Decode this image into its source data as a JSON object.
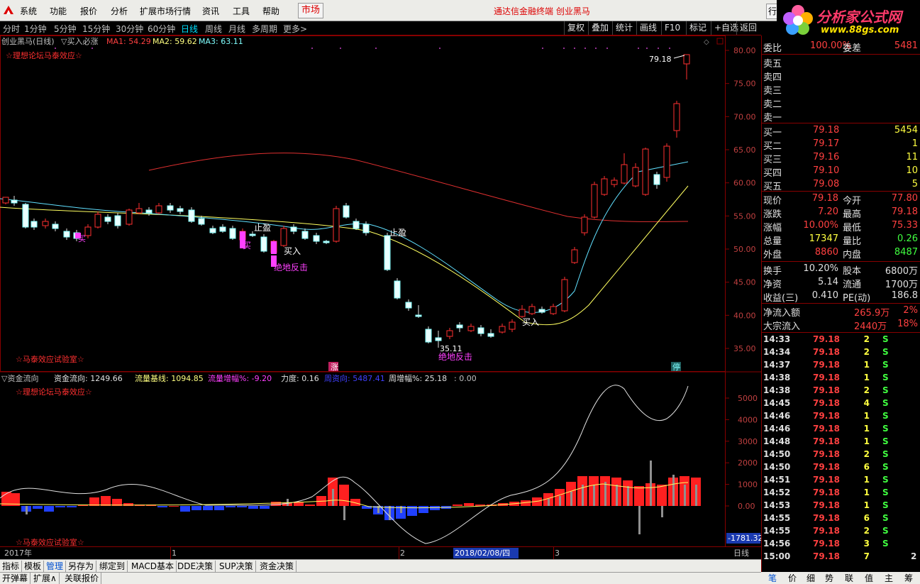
{
  "menu": {
    "items": [
      "系统",
      "功能",
      "报价",
      "分析",
      "扩展市场行情",
      "资讯",
      "工具",
      "帮助"
    ],
    "market": "市场",
    "title": "通达信金融终端  创业黑马",
    "window_btn": "行",
    "brand_line1": "分析家公式网",
    "brand_line2": "www.88gs.com"
  },
  "toolbar": {
    "periods": [
      "分时",
      "1分钟",
      "5分钟",
      "15分钟",
      "30分钟",
      "60分钟",
      "日线",
      "周线",
      "月线",
      "多周期",
      "更多>"
    ],
    "active_period": "日线",
    "right_buttons": [
      "复权",
      "叠加",
      "统计",
      "画线",
      "F10",
      "标记",
      "+自选",
      "返回"
    ]
  },
  "main_chart": {
    "stock": "创业黑马(日线)",
    "indicator": "▽买入必涨",
    "ma1": "MA1: 54.29",
    "ma2": "MA2: 59.62",
    "ma3": "MA3: 63.11",
    "watermark_top": "☆理想论坛马泰效应☆",
    "watermark_bottom": "☆马泰效应试验室☆",
    "price_axis": [
      "80.00",
      "75.00",
      "70.00",
      "65.00",
      "60.00",
      "55.00",
      "50.00",
      "45.00",
      "40.00",
      "35.00"
    ],
    "high_label": "79.18",
    "low_label": "35.11",
    "signals": {
      "buy1": "买",
      "buy2": "买",
      "buy_in1": "买入",
      "buy_in2": "买入",
      "stop1": "止盈",
      "stop2": "止盈",
      "rebound1": "绝地反击",
      "rebound2": "绝地反击",
      "rise": "涨",
      "limit": "停"
    }
  },
  "sub_chart": {
    "name": "▽资金流向",
    "flow": "资金流向: 1249.66",
    "base": "流量基线: 1094.85",
    "inc": "流量增幅%: -9.20",
    "force": "力度: 0.16",
    "weekly": "周资向: 5487.41",
    "weekly_inc": "周增幅%: 25.18",
    "zero": ": 0.00",
    "watermark_top": "☆理想论坛马泰效应☆",
    "watermark_bottom": "☆马泰效应试验室☆",
    "axis": [
      "5000",
      "4000",
      "3000",
      "2000",
      "1000",
      "0.00"
    ],
    "cursor_value": "-1781.32"
  },
  "time_axis": {
    "year": "2017年",
    "m1": "1",
    "m2": "2",
    "m3": "3",
    "cursor_date": "2018/02/08/四",
    "period": "日线"
  },
  "quote": {
    "weibi_label": "委比",
    "weibi": "100.00%",
    "weicha_label": "委差",
    "weicha": "5481",
    "sells": [
      "卖五",
      "卖四",
      "卖三",
      "卖二",
      "卖一"
    ],
    "buys": [
      {
        "label": "买一",
        "price": "79.18",
        "vol": "5454"
      },
      {
        "label": "买二",
        "price": "79.17",
        "vol": "1"
      },
      {
        "label": "买三",
        "price": "79.16",
        "vol": "11"
      },
      {
        "label": "买四",
        "price": "79.10",
        "vol": "10"
      },
      {
        "label": "买五",
        "price": "79.08",
        "vol": "5"
      }
    ],
    "stats": [
      [
        "现价",
        "79.18",
        "今开",
        "77.80"
      ],
      [
        "涨跌",
        "7.20",
        "最高",
        "79.18"
      ],
      [
        "涨幅",
        "10.00%",
        "最低",
        "75.33"
      ],
      [
        "总量",
        "17347",
        "量比",
        "0.26"
      ],
      [
        "外盘",
        "8860",
        "内盘",
        "8487"
      ]
    ],
    "stats2": [
      [
        "换手",
        "10.20%",
        "股本",
        "6800万"
      ],
      [
        "净资",
        "5.14",
        "流通",
        "1700万"
      ],
      [
        "收益(三)",
        "0.410",
        "PE(动)",
        "186.8"
      ]
    ],
    "netflow_label": "净流入额",
    "netflow": "265.9万",
    "netflow_pct": "2%",
    "block_label": "大宗流入",
    "block": "2440万",
    "block_pct": "18%"
  },
  "ticks": [
    [
      "14:33",
      "79.18",
      "2",
      "S"
    ],
    [
      "14:34",
      "79.18",
      "2",
      "S"
    ],
    [
      "14:37",
      "79.18",
      "1",
      "S"
    ],
    [
      "14:38",
      "79.18",
      "1",
      "S"
    ],
    [
      "14:38",
      "79.18",
      "2",
      "S"
    ],
    [
      "14:45",
      "79.18",
      "4",
      "S"
    ],
    [
      "14:46",
      "79.18",
      "1",
      "S"
    ],
    [
      "14:46",
      "79.18",
      "1",
      "S"
    ],
    [
      "14:48",
      "79.18",
      "1",
      "S"
    ],
    [
      "14:50",
      "79.18",
      "2",
      "S"
    ],
    [
      "14:50",
      "79.18",
      "6",
      "S"
    ],
    [
      "14:51",
      "79.18",
      "1",
      "S"
    ],
    [
      "14:52",
      "79.18",
      "1",
      "S"
    ],
    [
      "14:53",
      "79.18",
      "1",
      "S"
    ],
    [
      "14:55",
      "79.18",
      "6",
      "S"
    ],
    [
      "14:55",
      "79.18",
      "2",
      "S"
    ],
    [
      "14:56",
      "79.18",
      "3",
      "S"
    ],
    [
      "15:00",
      "79.18",
      "7",
      "2"
    ]
  ],
  "bottom_tabs": [
    "指标",
    "模板",
    "管理",
    "另存为",
    "绑定到",
    "MACD基本",
    "DDE决策",
    "SUP决策",
    "资金决策"
  ],
  "bottom_tabs2": [
    "开弹幕",
    "扩展∧",
    "关联报价"
  ],
  "right_tabs": [
    "笔",
    "价",
    "细",
    "势",
    "联",
    "值",
    "主",
    "筹"
  ],
  "pm": [
    "+",
    "−"
  ]
}
